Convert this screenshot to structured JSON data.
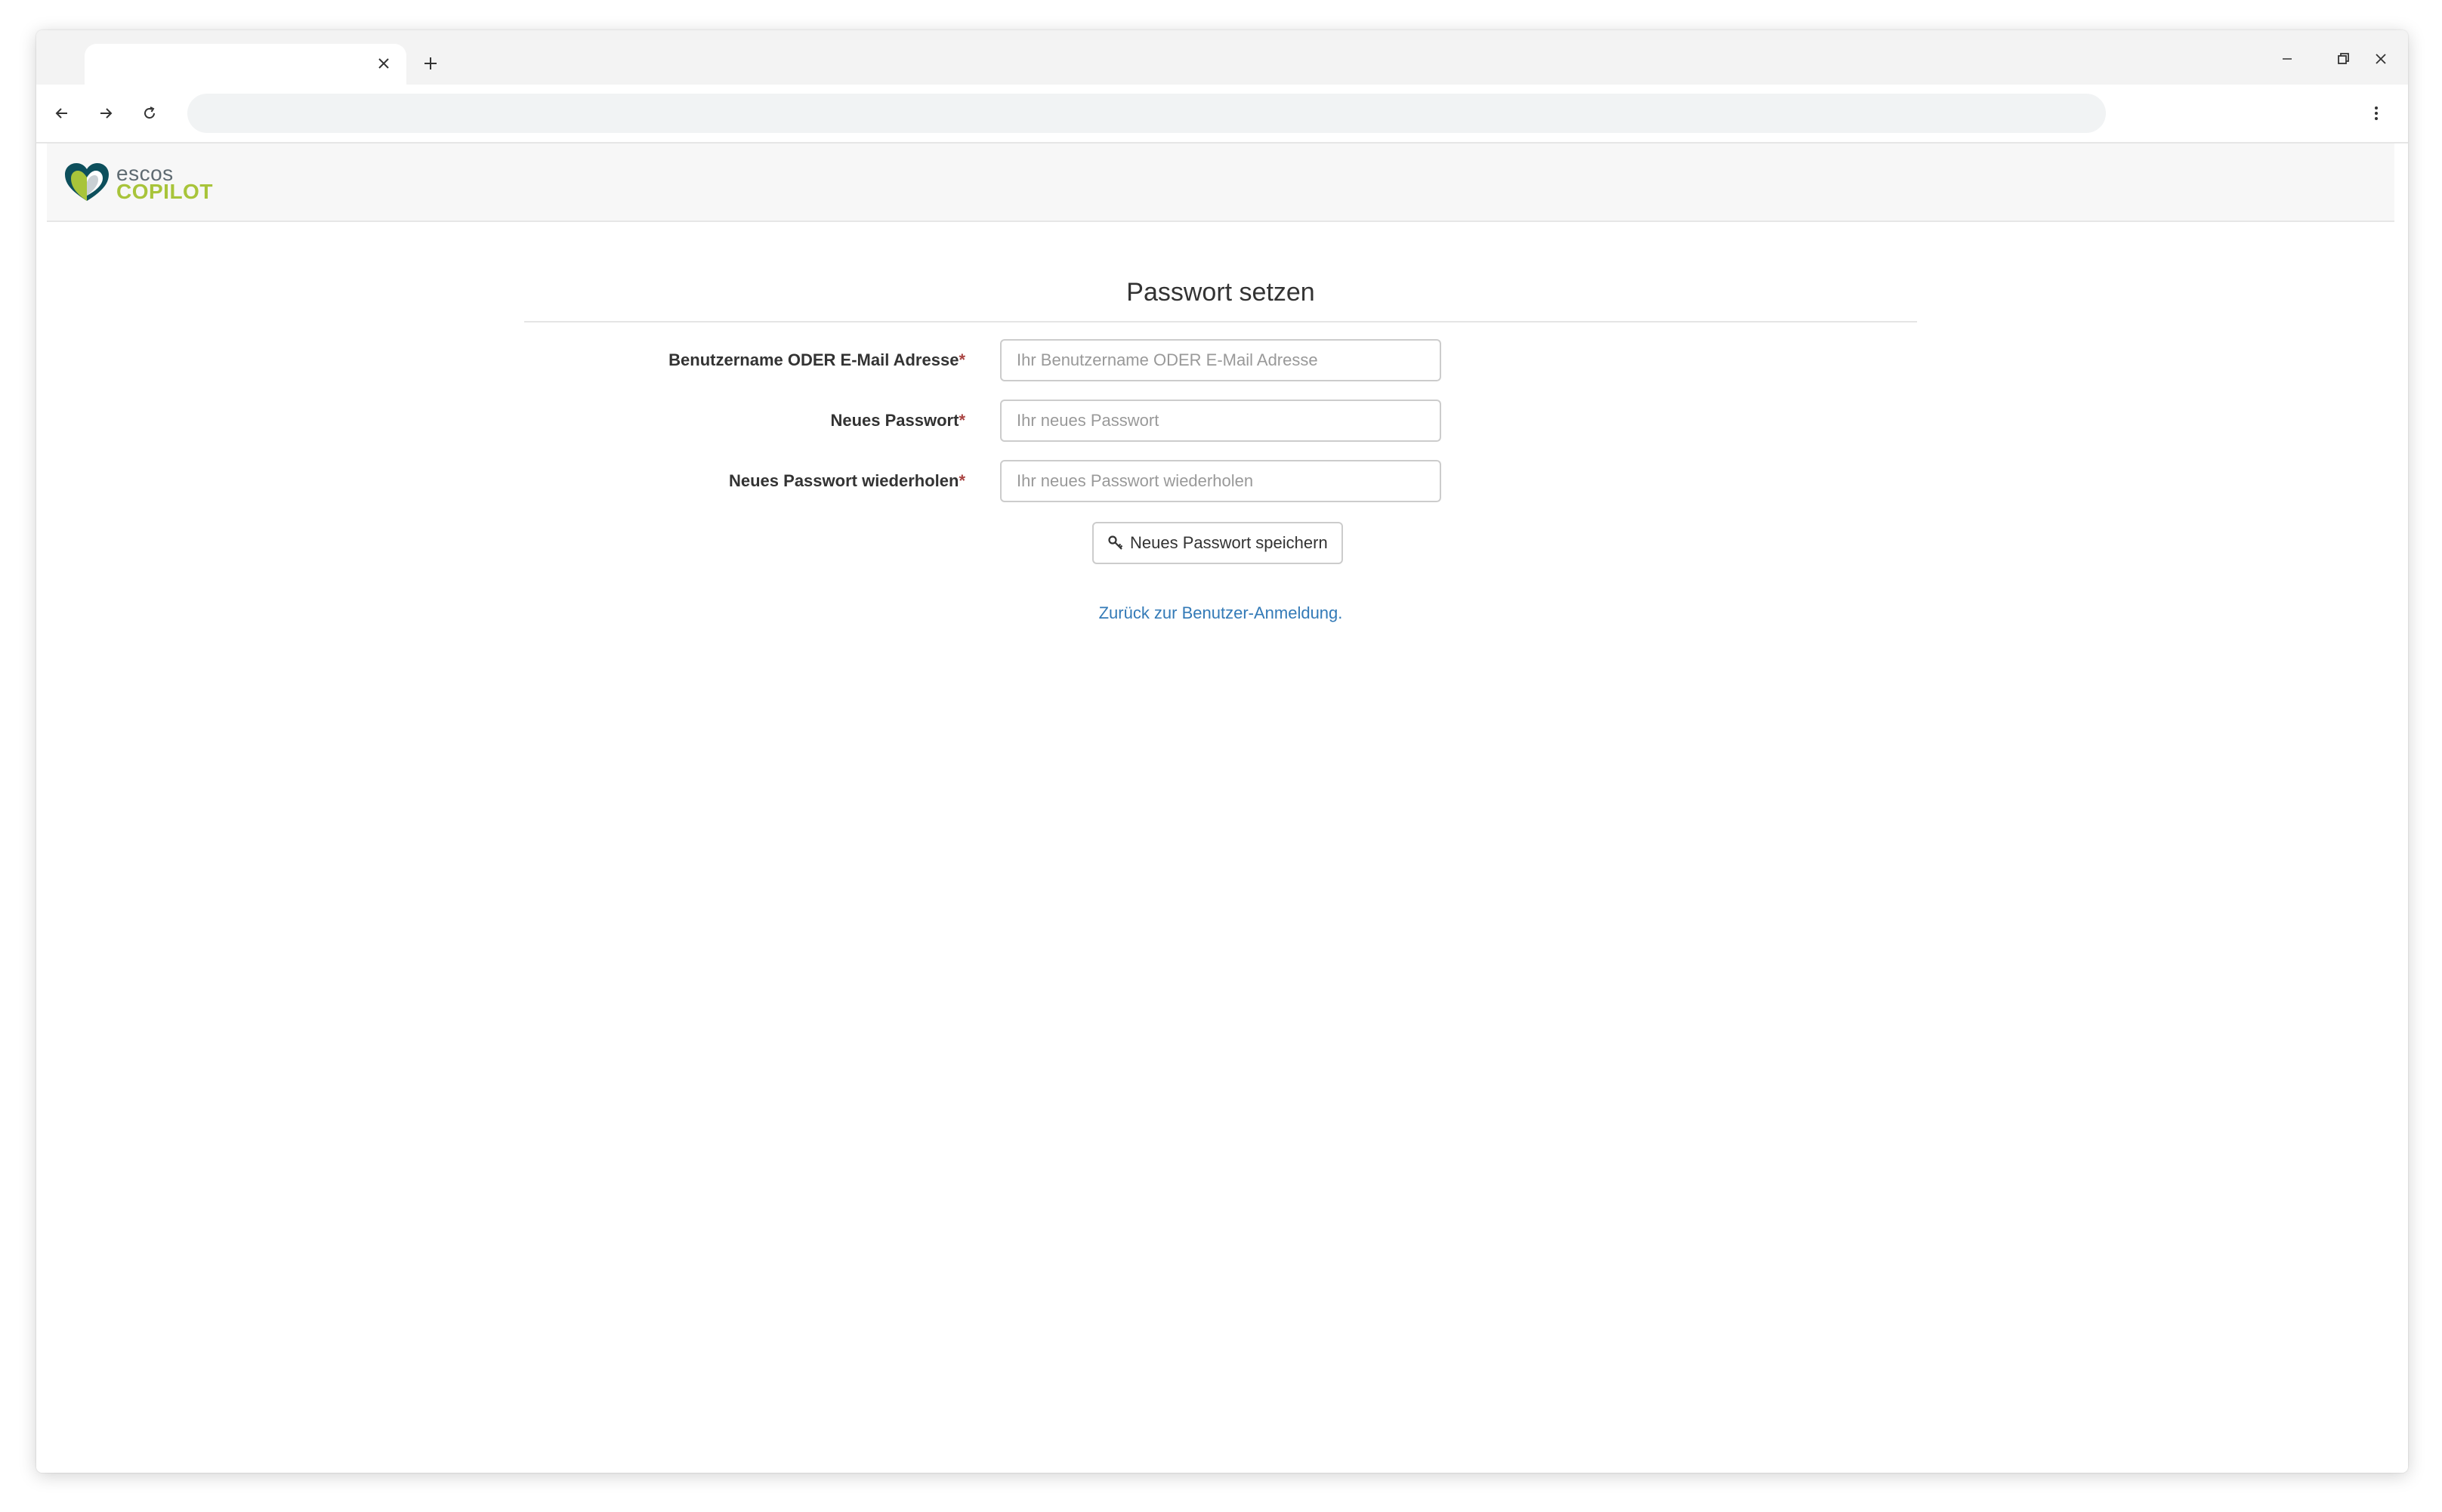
{
  "browser": {
    "tab_title": "",
    "address": ""
  },
  "header": {
    "logo_line1": "escos",
    "logo_line2": "COPILOT"
  },
  "form": {
    "title": "Passwort setzen",
    "required_marker": "*",
    "fields": [
      {
        "label": "Benutzername ODER E-Mail Adresse",
        "placeholder": "Ihr Benutzername ODER E-Mail Adresse",
        "value": ""
      },
      {
        "label": "Neues Passwort",
        "placeholder": "Ihr neues Passwort",
        "value": ""
      },
      {
        "label": "Neues Passwort wiederholen",
        "placeholder": "Ihr neues Passwort wiederholen",
        "value": ""
      }
    ],
    "submit_label": "Neues Passwort speichern",
    "back_link": "Zurück zur Benutzer-Anmeldung."
  },
  "icons": {
    "tab_close": "close-icon",
    "new_tab": "plus-icon",
    "back": "arrow-left-icon",
    "forward": "arrow-right-icon",
    "reload": "reload-icon",
    "menu": "kebab-menu-icon",
    "submit": "key-icon"
  },
  "colors": {
    "link": "#337ab7",
    "required": "#a94442",
    "logo_gray": "#5f6b72",
    "logo_green": "#a8c43a"
  }
}
